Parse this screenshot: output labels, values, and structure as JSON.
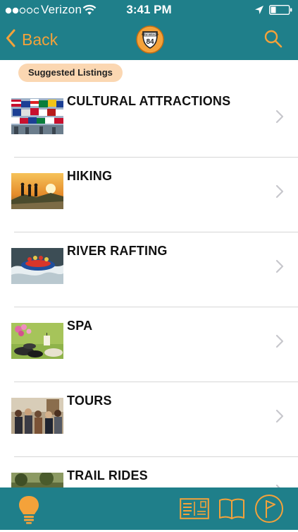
{
  "status_bar": {
    "carrier": "Verizon",
    "time": "3:41 PM",
    "signal_icon": "signal-dots-icon",
    "wifi_icon": "wifi-icon",
    "location_icon": "location-arrow-icon",
    "battery_icon": "battery-icon",
    "battery_level": 0.25
  },
  "nav_bar": {
    "back_label": "Back",
    "back_icon": "chevron-left-icon",
    "logo_text_top": "NEW MEXICO",
    "logo_text_number": "84",
    "search_icon": "search-icon"
  },
  "section": {
    "label": "Suggested Listings"
  },
  "listings": [
    {
      "title": "CULTURAL ATTRACTIONS",
      "thumbnail": "flags-photo"
    },
    {
      "title": "HIKING",
      "thumbnail": "hikers-sunset-photo"
    },
    {
      "title": "RIVER RAFTING",
      "thumbnail": "rafting-photo"
    },
    {
      "title": "SPA",
      "thumbnail": "spa-orchid-photo"
    },
    {
      "title": "TOURS",
      "thumbnail": "tour-group-photo"
    },
    {
      "title": "TRAIL RIDES",
      "thumbnail": "trail-ride-photo"
    }
  ],
  "tab_bar": {
    "tabs": [
      {
        "icon": "lightbulb-icon",
        "active": true
      },
      {
        "icon": "postcard-icon",
        "active": false
      },
      {
        "icon": "book-icon",
        "active": false
      },
      {
        "icon": "map-flag-icon",
        "active": false
      }
    ]
  },
  "colors": {
    "bar_teal": "#1f7f8a",
    "accent_orange": "#f4a23a",
    "pill_bg": "#fbd7b2",
    "divider": "#d6d6d6",
    "chevron": "#c7c7cc"
  }
}
